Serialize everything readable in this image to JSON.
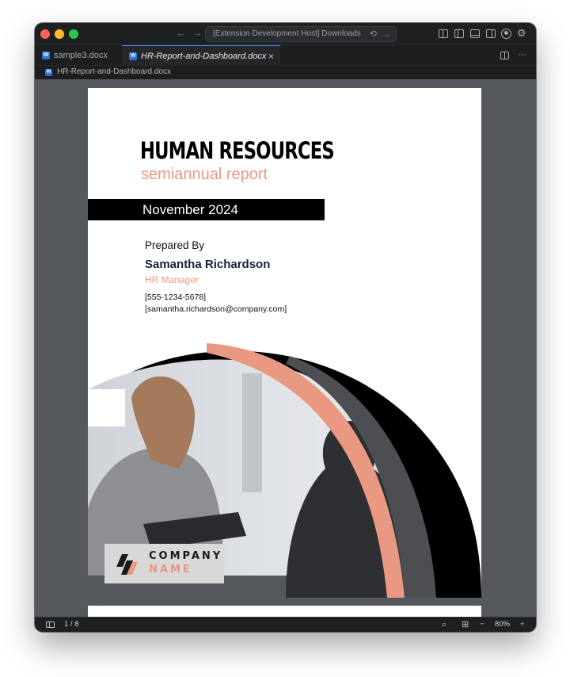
{
  "window": {
    "command_center": "[Extension Development Host] Downloads",
    "nav_back": "←",
    "nav_forward": "→",
    "copilot_icon": "⟲",
    "chevron": "⌄"
  },
  "tabs": [
    {
      "label": "sample3.docx",
      "active": false
    },
    {
      "label": "HR-Report-and-Dashboard.docx",
      "active": true
    }
  ],
  "tab_close": "×",
  "tab_more": "···",
  "breadcrumb": "HR-Report-and-Dashboard.docx",
  "document": {
    "title": "HUMAN RESOURCES",
    "subtitle": "semiannual report",
    "date": "November 2024",
    "prepared_label": "Prepared By",
    "prepared_name": "Samantha Richardson",
    "prepared_role": "HR Manager",
    "phone": "[555-1234-5678]",
    "email": "[samantha.richardson@company.com]",
    "logo_line1": "COMPANY",
    "logo_line2": "NAME"
  },
  "statusbar": {
    "page_indicator": "1 / 8",
    "zoom": "80%",
    "zoom_out": "−",
    "zoom_in": "+",
    "search_icon": "⌕",
    "grid_icon": "⊞"
  },
  "colors": {
    "accent": "#e99882",
    "ink": "#000000",
    "viewer_bg": "#55585c"
  }
}
